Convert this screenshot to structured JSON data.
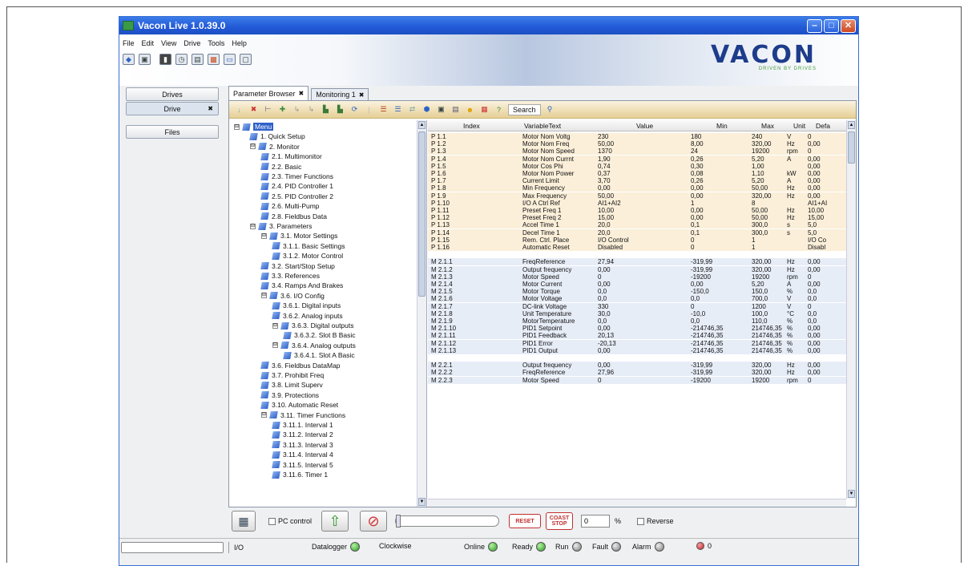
{
  "window": {
    "title": "Vacon Live 1.0.39.0"
  },
  "menu": [
    "File",
    "Edit",
    "View",
    "Drive",
    "Tools",
    "Help"
  ],
  "logo": {
    "name": "VACON",
    "tagline": "DRIVEN BY DRIVES"
  },
  "left": {
    "drives": "Drives",
    "drive": "Drive",
    "files": "Files"
  },
  "tabs": [
    {
      "label": "Parameter Browser"
    },
    {
      "label": "Monitoring 1"
    }
  ],
  "search": {
    "label": "Search"
  },
  "tree": [
    {
      "label": "Menu",
      "sel": true,
      "exp": "⊟"
    },
    {
      "label": "1. Quick Setup"
    },
    {
      "label": "2. Monitor",
      "exp": "⊟"
    },
    {
      "label": "2.1. Multimonitor"
    },
    {
      "label": "2.2. Basic"
    },
    {
      "label": "2.3. Timer Functions"
    },
    {
      "label": "2.4. PID Controller 1"
    },
    {
      "label": "2.5. PID Controller 2"
    },
    {
      "label": "2.6. Multi-Pump"
    },
    {
      "label": "2.8. Fieldbus Data"
    },
    {
      "label": "3. Parameters",
      "exp": "⊟"
    },
    {
      "label": "3.1. Motor Settings",
      "exp": "⊟"
    },
    {
      "label": "3.1.1. Basic Settings"
    },
    {
      "label": "3.1.2. Motor Control"
    },
    {
      "label": "3.2. Start/Stop Setup"
    },
    {
      "label": "3.3. References"
    },
    {
      "label": "3.4. Ramps And Brakes"
    },
    {
      "label": "3.6. I/O Config",
      "exp": "⊟"
    },
    {
      "label": "3.6.1. Digital inputs"
    },
    {
      "label": "3.6.2. Analog inputs"
    },
    {
      "label": "3.6.3. Digital outputs",
      "exp": "⊟"
    },
    {
      "label": "3.6.3.2. Slot B Basic"
    },
    {
      "label": "3.6.4. Analog outputs",
      "exp": "⊟"
    },
    {
      "label": "3.6.4.1. Slot A Basic"
    },
    {
      "label": "3.6. Fieldbus DataMap"
    },
    {
      "label": "3.7. Prohibit Freq"
    },
    {
      "label": "3.8. Limit Superv"
    },
    {
      "label": "3.9. Protections"
    },
    {
      "label": "3.10. Automatic Reset"
    },
    {
      "label": "3.11. Timer Functions",
      "exp": "⊟"
    },
    {
      "label": "3.11.1. Interval 1"
    },
    {
      "label": "3.11.2. Interval 2"
    },
    {
      "label": "3.11.3. Interval 3"
    },
    {
      "label": "3.11.4. Interval 4"
    },
    {
      "label": "3.11.5. Interval 5"
    },
    {
      "label": "3.11.6. Timer 1"
    }
  ],
  "columns": [
    "Index",
    "VariableText",
    "Value",
    "Min",
    "Max",
    "Unit",
    "Defa"
  ],
  "rows": [
    [
      "P 1.1",
      "Motor Nom Voltg",
      "230",
      "180",
      "240",
      "V",
      "0"
    ],
    [
      "P 1.2",
      "Motor Nom Freq",
      "50,00",
      "8,00",
      "320,00",
      "Hz",
      "0,00"
    ],
    [
      "P 1.3",
      "Motor Nom Speed",
      "1370",
      "24",
      "19200",
      "rpm",
      "0"
    ],
    [
      "P 1.4",
      "Motor Nom Currnt",
      "1,90",
      "0,26",
      "5,20",
      "A",
      "0,00"
    ],
    [
      "P 1.5",
      "Motor Cos Phi",
      "0,74",
      "0,30",
      "1,00",
      "",
      "0,00"
    ],
    [
      "P 1.6",
      "Motor Nom Power",
      "0,37",
      "0,08",
      "1,10",
      "kW",
      "0,00"
    ],
    [
      "P 1.7",
      "Current Limit",
      "3,70",
      "0,26",
      "5,20",
      "A",
      "0,00"
    ],
    [
      "P 1.8",
      "Min Frequency",
      "0,00",
      "0,00",
      "50,00",
      "Hz",
      "0,00"
    ],
    [
      "P 1.9",
      "Max Frequency",
      "50,00",
      "0,00",
      "320,00",
      "Hz",
      "0,00"
    ],
    [
      "P 1.10",
      "I/O A Ctrl Ref",
      "AI1+AI2",
      "1",
      "8",
      "",
      "AI1+AI"
    ],
    [
      "P 1.11",
      "Preset Freq 1",
      "10,00",
      "0,00",
      "50,00",
      "Hz",
      "10,00"
    ],
    [
      "P 1.12",
      "Preset Freq 2",
      "15,00",
      "0,00",
      "50,00",
      "Hz",
      "15,00"
    ],
    [
      "P 1.13",
      "Accel Time 1",
      "20,0",
      "0,1",
      "300,0",
      "s",
      "5,0"
    ],
    [
      "P 1.14",
      "Decel Time 1",
      "20,0",
      "0,1",
      "300,0",
      "s",
      "5,0"
    ],
    [
      "P 1.15",
      "Rem. Ctrl. Place",
      "I/O Control",
      "0",
      "1",
      "",
      "I/O Co"
    ],
    [
      "P 1.16",
      "Automatic Reset",
      "Disabled",
      "0",
      "1",
      "",
      "Disabl"
    ],
    null,
    [
      "M 2.1.1",
      "FreqReference",
      "27,94",
      "-319,99",
      "320,00",
      "Hz",
      "0,00"
    ],
    [
      "M 2.1.2",
      "Output frequency",
      "0,00",
      "-319,99",
      "320,00",
      "Hz",
      "0,00"
    ],
    [
      "M 2.1.3",
      "Motor Speed",
      "0",
      "-19200",
      "19200",
      "rpm",
      "0"
    ],
    [
      "M 2.1.4",
      "Motor Current",
      "0,00",
      "0,00",
      "5,20",
      "A",
      "0,00"
    ],
    [
      "M 2.1.5",
      "Motor Torque",
      "0,0",
      "-150,0",
      "150,0",
      "%",
      "0,0"
    ],
    [
      "M 2.1.6",
      "Motor Voltage",
      "0,0",
      "0,0",
      "700,0",
      "V",
      "0,0"
    ],
    [
      "M 2.1.7",
      "DC-link Voltage",
      "330",
      "0",
      "1200",
      "V",
      "0"
    ],
    [
      "M 2.1.8",
      "Unit Temperature",
      "30,0",
      "-10,0",
      "100,0",
      "°C",
      "0,0"
    ],
    [
      "M 2.1.9",
      "MotorTemperature",
      "0,0",
      "0,0",
      "110,0",
      "%",
      "0,0"
    ],
    [
      "M 2.1.10",
      "PID1 Setpoint",
      "0,00",
      "-214746,35",
      "214746,35",
      "%",
      "0,00"
    ],
    [
      "M 2.1.11",
      "PID1 Feedback",
      "20,13",
      "-214746,35",
      "214746,35",
      "%",
      "0,00"
    ],
    [
      "M 2.1.12",
      "PID1 Error",
      "-20,13",
      "-214746,35",
      "214746,35",
      "%",
      "0,00"
    ],
    [
      "M 2.1.13",
      "PID1 Output",
      "0,00",
      "-214746,35",
      "214746,35",
      "%",
      "0,00"
    ],
    null,
    [
      "M 2.2.1",
      "Output frequency",
      "0,00",
      "-319,99",
      "320,00",
      "Hz",
      "0,00"
    ],
    [
      "M 2.2.2",
      "FreqReference",
      "27,96",
      "-319,99",
      "320,00",
      "Hz",
      "0,00"
    ],
    [
      "M 2.2.3",
      "Motor Speed",
      "0",
      "-19200",
      "19200",
      "rpm",
      "0"
    ]
  ],
  "controls": {
    "pc_control": "PC control",
    "reset": "RESET",
    "coast": "COAST",
    "stop": "STOP",
    "speed_value": "0",
    "percent": "%",
    "reverse": "Reverse"
  },
  "status": {
    "io": "I/O",
    "datalogger": "Datalogger",
    "clockwise": "Clockwise",
    "online": "Online",
    "ready": "Ready",
    "run": "Run",
    "fault": "Fault",
    "alarm": "Alarm",
    "alarm_count": "0"
  }
}
